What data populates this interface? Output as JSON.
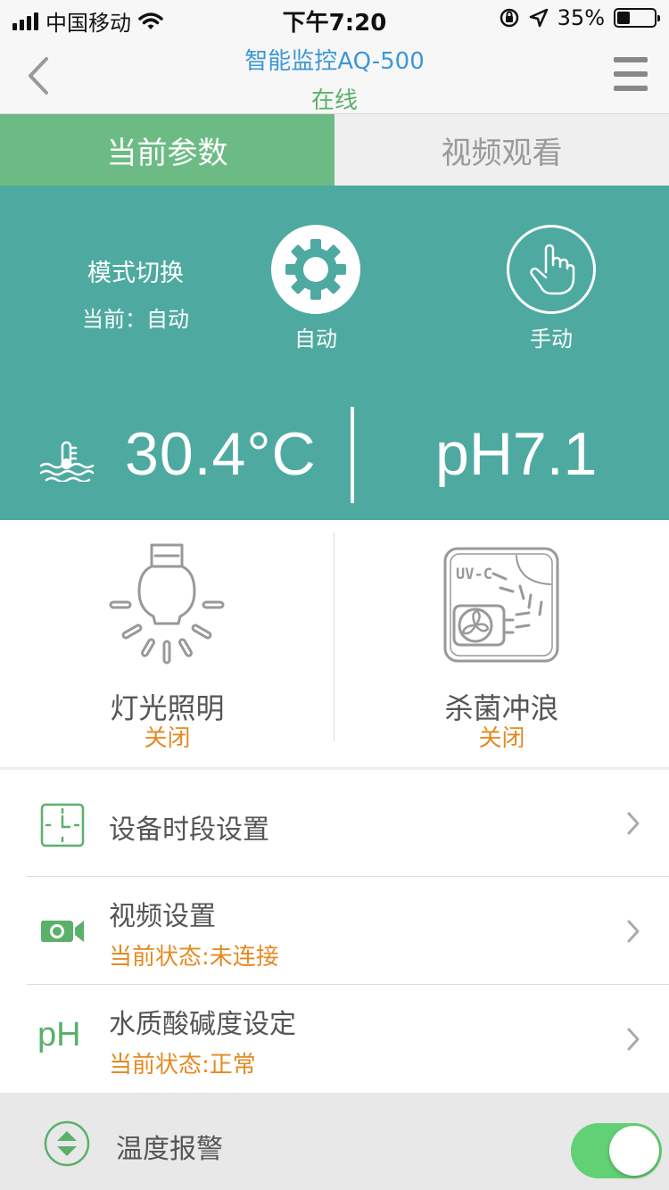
{
  "status_bar": {
    "carrier": "中国移动",
    "time": "下午7:20",
    "battery_text": "35%",
    "battery_level": 0.35
  },
  "nav": {
    "title": "智能监控AQ-500",
    "subtitle": "在线"
  },
  "tabs": [
    {
      "label": "当前参数",
      "active": true
    },
    {
      "label": "视频观看",
      "active": false
    }
  ],
  "mode": {
    "label": "模式切换",
    "current": "当前：自动",
    "auto_label": "自动",
    "manual_label": "手动"
  },
  "readings": {
    "temperature": "30.4°C",
    "ph": "pH7.1"
  },
  "devices": [
    {
      "name": "灯光照明",
      "state": "关闭",
      "icon": "lightbulb-icon"
    },
    {
      "name": "杀菌冲浪",
      "state": "关闭",
      "icon": "uv-fan-icon",
      "icon_text": "UV-C"
    }
  ],
  "settings": [
    {
      "title": "设备时段设置",
      "icon": "clock-icon"
    },
    {
      "title": "视频设置",
      "status": "当前状态:未连接",
      "icon": "camera-icon"
    },
    {
      "title": "水质酸碱度设定",
      "status": "当前状态:正常",
      "icon_text": "pH"
    }
  ],
  "alarm": {
    "label": "温度报警",
    "enabled": true
  },
  "colors": {
    "teal": "#4eaaa0",
    "green": "#6dbb84",
    "orange": "#e58a22",
    "title_blue": "#3d97d6",
    "toggle_on": "#62d074"
  }
}
